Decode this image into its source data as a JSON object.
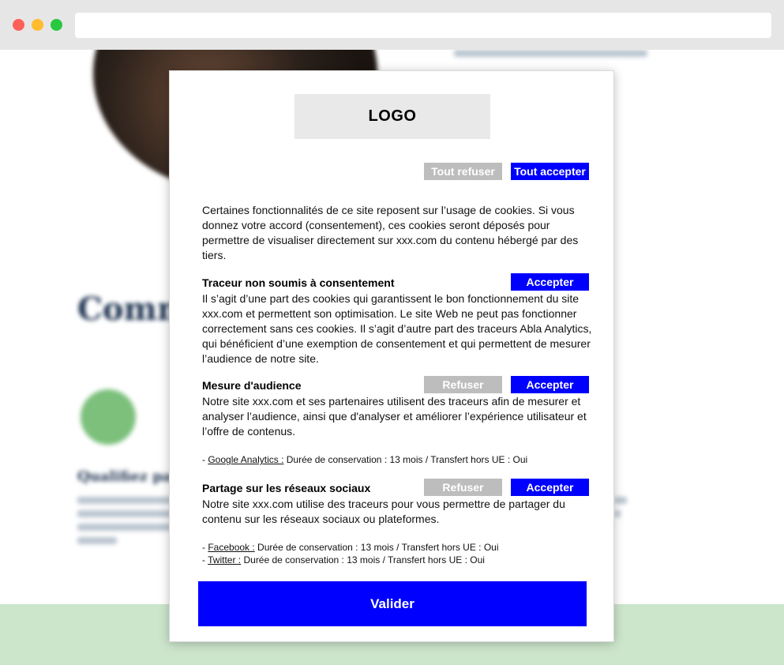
{
  "modal": {
    "logo": "LOGO",
    "refuse_all": "Tout refuser",
    "accept_all": "Tout accepter",
    "intro": "Certaines fonctionnalités de ce site reposent sur l’usage de cookies. Si vous donnez votre accord (consentement), ces cookies seront déposés pour permettre de visualiser directement sur xxx.com du contenu hébergé par des tiers.",
    "sections": [
      {
        "title": "Traceur non soumis à consentement",
        "accept": "Accepter",
        "text": "Il s’agit d’une part des cookies qui garantissent le bon fonctionnement du site xxx.com et permettent son optimisation. Le site Web ne peut pas fonctionner correctement sans ces cookies. Il s’agit d’autre part des traceurs Abla Analytics, qui bénéficient d’une exemption de consentement et qui permettent de mesurer l’audience de notre site."
      },
      {
        "title": "Mesure d'audience",
        "refuse": "Refuser",
        "accept": "Accepter",
        "text": "Notre site xxx.com et ses partenaires utilisent des traceurs afin de mesurer et analyser l’audience, ainsi que d'analyser et améliorer l’expérience utilisateur et l’offre de contenus.",
        "details": [
          {
            "prefix": "- ",
            "link": "Google Analytics :",
            "info": " Durée de conservation : 13 mois / Transfert hors UE : Oui"
          }
        ]
      },
      {
        "title": "Partage sur les réseaux sociaux",
        "refuse": "Refuser",
        "accept": "Accepter",
        "text": "Notre site xxx.com utilise des traceurs pour vous permettre de partager du contenu sur les réseaux sociaux ou plateformes.",
        "details": [
          {
            "prefix": "- ",
            "link": "Facebook :",
            "info": "  Durée de conservation : 13 mois / Transfert hors UE : Oui"
          },
          {
            "prefix": "- ",
            "link": "Twitter :",
            "info": "  Durée de conservation : 13 mois / Transfert hors UE : Oui"
          }
        ]
      }
    ],
    "validate": "Valider"
  },
  "background": {
    "heading": "Comm",
    "subheading": "Qualifiez par"
  },
  "colors": {
    "accent": "#0000ff",
    "disabled": "#bdbdbd",
    "bg_green": "#cce6cc"
  }
}
